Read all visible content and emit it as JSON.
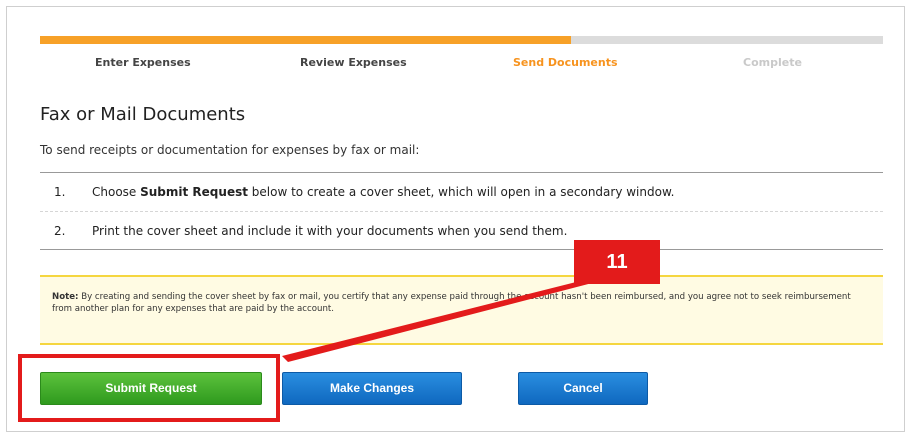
{
  "progress": {
    "fraction": 0.63,
    "steps": [
      {
        "label": "Enter Expenses",
        "state": "done"
      },
      {
        "label": "Review Expenses",
        "state": "done"
      },
      {
        "label": "Send Documents",
        "state": "current"
      },
      {
        "label": "Complete",
        "state": "upcoming"
      }
    ]
  },
  "page": {
    "title": "Fax or Mail Documents",
    "intro": "To send receipts or documentation for expenses by fax or mail:"
  },
  "instructions": [
    {
      "num": "1.",
      "before": "Choose ",
      "bold": "Submit Request",
      "after": " below to create a cover sheet, which will open in a secondary window."
    },
    {
      "num": "2.",
      "before": "Print the cover sheet and include it with your documents when you send them.",
      "bold": "",
      "after": ""
    }
  ],
  "note": {
    "label": "Note:",
    "text": " By creating and sending the cover sheet by fax or mail, you certify that any expense paid through the account hasn't been reimbursed, and you agree not to seek reimbursement from another plan for any expenses that are paid by the account."
  },
  "buttons": {
    "submit": "Submit Request",
    "change": "Make Changes",
    "cancel": "Cancel"
  },
  "annotation": {
    "badge": "11"
  },
  "colors": {
    "progress_fill": "#f7a128",
    "current_step": "#f7931e",
    "submit_green": "#3aa827",
    "action_blue": "#1a7ad4",
    "annotation_red": "#e31b1b",
    "note_bg": "#fffbe3"
  }
}
